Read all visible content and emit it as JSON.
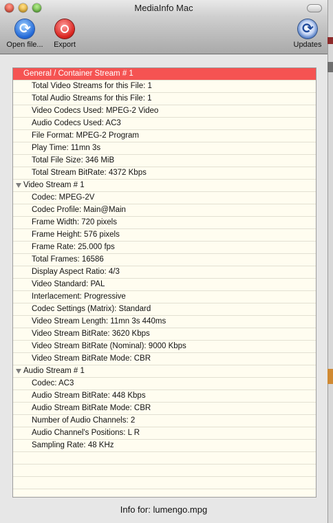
{
  "window": {
    "title": "MediaInfo Mac"
  },
  "toolbar": {
    "open_label": "Open file...",
    "export_label": "Export",
    "updates_label": "Updates",
    "icons": {
      "open": "open-file-icon",
      "export": "export-icon",
      "updates": "updates-icon"
    }
  },
  "tree": {
    "general": {
      "header": "General / Container Stream # 1",
      "items": [
        "Total Video Streams for this File: 1",
        "Total Audio Streams for this File: 1",
        "Video Codecs Used: MPEG-2 Video",
        "Audio Codecs Used: AC3",
        "File Format: MPEG-2 Program",
        "Play Time: 11mn 3s",
        "Total File Size: 346 MiB",
        "Total Stream BitRate: 4372 Kbps"
      ]
    },
    "video": {
      "header": "Video Stream # 1",
      "items": [
        "Codec: MPEG-2V",
        "Codec Profile: Main@Main",
        "Frame Width: 720 pixels",
        "Frame Height: 576 pixels",
        "Frame Rate: 25.000 fps",
        "Total Frames: 16586",
        "Display Aspect Ratio: 4/3",
        "Video Standard: PAL",
        "Interlacement: Progressive",
        "Codec Settings (Matrix): Standard",
        "Video Stream Length: 11mn 3s 440ms",
        "Video Stream BitRate: 3620 Kbps",
        "Video Stream BitRate (Nominal): 9000 Kbps",
        "Video Stream BitRate Mode: CBR"
      ]
    },
    "audio": {
      "header": "Audio Stream # 1",
      "items": [
        "Codec: AC3",
        "Audio Stream BitRate: 448 Kbps",
        "Audio Stream BitRate Mode: CBR",
        "Number of Audio Channels: 2",
        "Audio Channel's Positions: L R",
        "Sampling Rate: 48 KHz"
      ]
    }
  },
  "footer": {
    "info_text": "Info for: lumengo.mpg"
  },
  "colors": {
    "selection": "#f55352",
    "panel_background": "#fffdf0",
    "row_divider": "#e2e0d2"
  }
}
